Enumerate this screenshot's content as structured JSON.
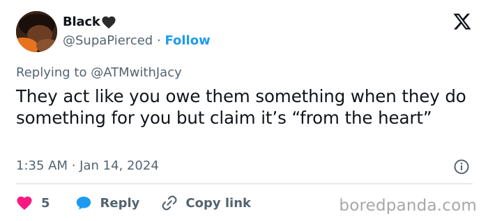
{
  "user": {
    "display_name": "Black",
    "handle": "@SupaPierced",
    "separator": "·",
    "follow_label": "Follow",
    "avatar_icon": "profile-photo"
  },
  "reply_context": {
    "prefix": "Replying to",
    "mention": "@ATMwithJacy"
  },
  "tweet": {
    "text": "They act like you owe them something when they do something for you but claim it’s “from the heart”",
    "timestamp": "1:35 AM · Jan 14, 2024"
  },
  "actions": {
    "like_count": "5",
    "reply_label": "Reply",
    "copy_label": "Copy link"
  },
  "watermark": "boredpanda.com",
  "colors": {
    "text": "#0f1419",
    "secondary": "#536471",
    "accent": "#1d9bf0",
    "like": "#f91880",
    "divider": "#cfd9de"
  }
}
